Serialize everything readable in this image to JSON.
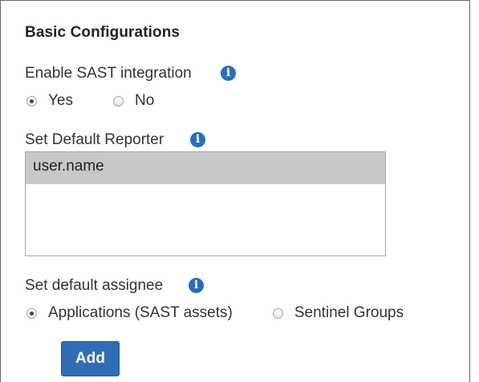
{
  "section": {
    "title": "Basic Configurations"
  },
  "sast": {
    "label": "Enable SAST integration",
    "options": [
      {
        "label": "Yes",
        "checked": true
      },
      {
        "label": "No",
        "checked": false
      }
    ]
  },
  "reporter": {
    "label": "Set Default Reporter",
    "options": [
      {
        "label": "user.name",
        "selected": true
      }
    ]
  },
  "assignee": {
    "label": "Set default assignee",
    "options": [
      {
        "label": "Applications (SAST assets)",
        "checked": true
      },
      {
        "label": "Sentinel Groups",
        "checked": false
      }
    ]
  },
  "actions": {
    "add_label": "Add"
  },
  "icons": {
    "info": "info-icon",
    "info_glyph": "i"
  },
  "colors": {
    "accent": "#2f6eb5",
    "info_icon": "#2b6cb8",
    "selected_option_bg": "#c8c8c8"
  }
}
